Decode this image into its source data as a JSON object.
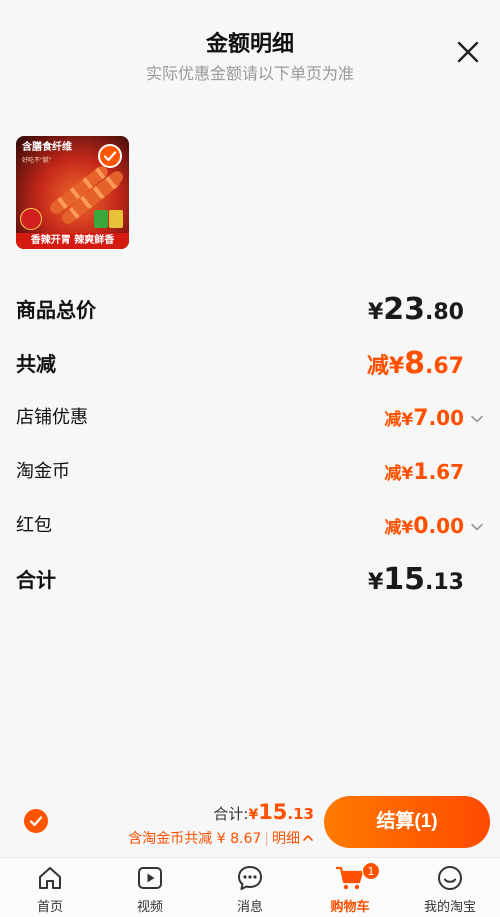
{
  "header": {
    "title": "金额明细",
    "subtitle": "实际优惠金额请以下单页为准"
  },
  "product": {
    "brand": "含膳食纤维",
    "brand_sub": "好吃不\"腻\"",
    "slogan": "香辣开胃 辣爽鲜香",
    "selected": true
  },
  "rows": {
    "total_price": {
      "label": "商品总价",
      "yen": "¥",
      "int": "23",
      "dec": ".80"
    },
    "total_discount": {
      "label": "共减",
      "prefix": "减",
      "yen": "¥",
      "int": "8",
      "dec": ".67"
    },
    "shop_discount": {
      "label": "店铺优惠",
      "prefix": "减",
      "yen": "¥",
      "int": "7",
      "dec": ".00"
    },
    "taojinbi": {
      "label": "淘金币",
      "prefix": "减",
      "yen": "¥",
      "int": "1",
      "dec": ".67"
    },
    "red_packet": {
      "label": "红包",
      "prefix": "减",
      "yen": "¥",
      "int": "0",
      "dec": ".00"
    },
    "grand_total": {
      "label": "合计",
      "yen": "¥",
      "int": "15",
      "dec": ".13"
    }
  },
  "footer": {
    "sum_label": "合计:",
    "sum_yen": "¥",
    "sum_int": "15",
    "sum_dec": ".13",
    "discount_text": "含淘金币共减 ¥ 8.67",
    "separator": "|",
    "detail_label": "明细",
    "checkout_label": "结算(1)"
  },
  "tabbar": {
    "tabs": [
      {
        "label": "首页",
        "icon": "home-icon"
      },
      {
        "label": "视频",
        "icon": "video-icon"
      },
      {
        "label": "消息",
        "icon": "message-icon"
      },
      {
        "label": "购物车",
        "icon": "cart-icon",
        "badge": "1",
        "active": true
      },
      {
        "label": "我的淘宝",
        "icon": "profile-icon"
      }
    ]
  },
  "colors": {
    "accent": "#ff5000",
    "checkout_gradient_start": "#ff7a00",
    "checkout_gradient_end": "#ff4a00",
    "background": "#f7f7f7"
  }
}
